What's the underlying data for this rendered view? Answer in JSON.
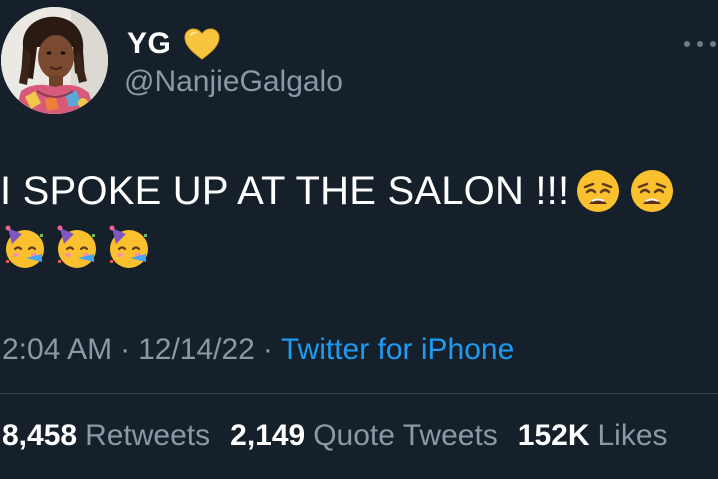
{
  "author": {
    "display_name": "YG",
    "handle": "@NanjieGalgalo",
    "badge_icon": "yellow-heart-icon"
  },
  "tweet": {
    "text": "I SPOKE UP AT THE SALON !!!",
    "emojis_line1": [
      "weary-face-icon",
      "weary-face-icon"
    ],
    "emojis_line2": [
      "partying-face-icon",
      "partying-face-icon",
      "partying-face-icon"
    ]
  },
  "meta": {
    "time": "2:04 AM",
    "separator": "·",
    "date": "12/14/22",
    "source": "Twitter for iPhone"
  },
  "stats": {
    "retweets_count": "8,458",
    "retweets_label": "Retweets",
    "quotes_count": "2,149",
    "quotes_label": "Quote Tweets",
    "likes_count": "152K",
    "likes_label": "Likes"
  },
  "colors": {
    "background": "#15202b",
    "secondary_text": "#8b98a5",
    "link": "#1d9bf0",
    "divider": "#38444d"
  }
}
